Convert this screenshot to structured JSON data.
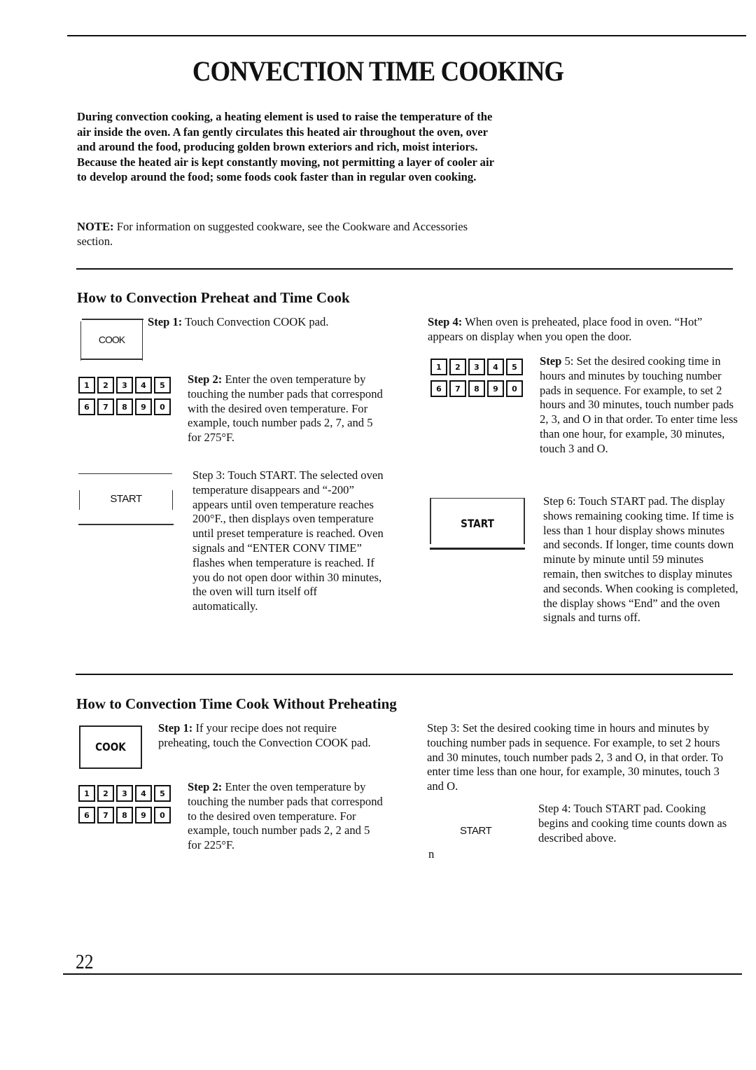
{
  "page": {
    "title": "CONVECTION TIME COOKING",
    "intro": "During convection cooking, a heating element is used to raise the temperature of the air inside the oven. A fan gently circulates this heated air throughout the oven, over and around the food, producing golden brown exteriors and rich, moist interiors. Because the heated air is kept constantly moving, not permitting a layer of cooler air to develop around the food; some foods cook faster than in regular oven cooking.",
    "note_label": "NOTE:",
    "note_text": " For information on suggested cookware, see the Cookware and Accessories section.",
    "page_number": "22"
  },
  "keypad": {
    "keys": [
      "1",
      "2",
      "3",
      "4",
      "5",
      "6",
      "7",
      "8",
      "9",
      "0"
    ]
  },
  "section1": {
    "heading": "How to Convection Preheat and Time Cook",
    "cook_pad_label": "COOK",
    "start_pad_label": "START",
    "start_pad_label_2": "START",
    "step1_label": "Step 1:",
    "step1_text": " Touch  Convection  COOK  pad.",
    "step2_label": "Step 2:",
    "step2_text": " Enter the oven temperature by touching the number pads that correspond with the desired oven temperature. For example, touch number pads 2, 7, and 5 for 275°F.",
    "step3_text": "Step 3: Touch START. The selected oven temperature disappears and “-200” appears until oven temperature reaches 200°F., then displays oven temperature until preset temperature is reached. Oven signals and “ENTER CONV TIME” flashes when temperature is reached. If you do not open door within 30 minutes, the oven will turn itself off automatically.",
    "step4_label": "Step 4:",
    "step4_text": " When oven is preheated, place food in oven. “Hot” appears on display when you open the door.",
    "step5_label": "Step",
    "step5_text": " 5: Set the desired cooking time in hours and minutes by touching number pads in sequence. For example, to set 2 hours and 30 minutes, touch number pads 2, 3, and O in that order. To enter time less than one hour, for example, 30 minutes, touch 3 and O.",
    "step6_text": "Step 6: Touch START pad. The display shows remaining cooking time. If time is less than 1 hour display shows minutes and seconds. If longer, time counts down minute by minute until 59 minutes remain, then switches to display minutes and seconds. When cooking is completed, the display shows “End” and the oven signals and turns off."
  },
  "section2": {
    "heading": "How to Convection Time Cook Without Preheating",
    "cook_pad_label": "COOK",
    "start_pad_label": "START",
    "stray_char": "n",
    "step1_label": "Step 1:",
    "step1_text": " If your recipe does not require preheating, touch the Convection COOK pad.",
    "step2_label": "Step 2:",
    "step2_text": " Enter the oven temperature by touching the number pads that correspond to the desired oven temperature. For example, touch number pads 2, 2 and 5 for 225°F.",
    "step3_text": "Step 3: Set the desired cooking time in hours and minutes by touching number pads in sequence. For example, to set 2 hours and 30 minutes, touch number pads 2, 3 and O, in that order. To enter time less than one hour, for example, 30 minutes, touch 3 and O.",
    "step4_text": "Step 4: Touch START pad. Cooking begins and cooking time counts down as described above."
  }
}
